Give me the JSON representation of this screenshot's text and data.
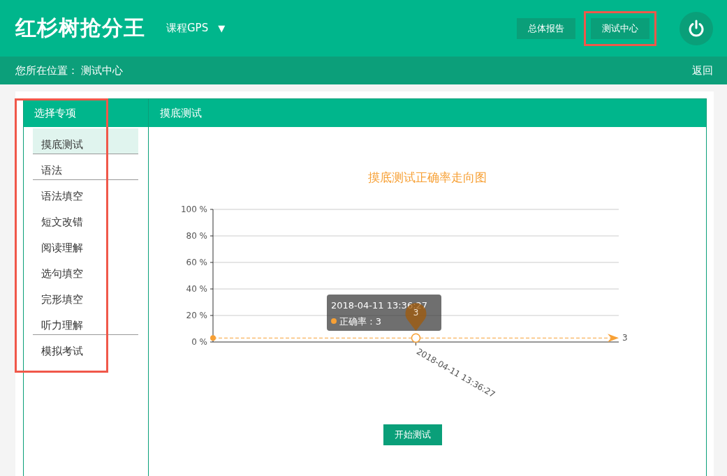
{
  "header": {
    "logo": "红杉树抢分王",
    "course_menu": "课程GPS",
    "caret": "▼",
    "nav": [
      {
        "label": "总体报告",
        "highlighted": false
      },
      {
        "label": "测试中心",
        "highlighted": true
      }
    ]
  },
  "breadcrumb": {
    "label": "您所在位置：",
    "current": "测试中心",
    "back": "返回"
  },
  "sidebar": {
    "title": "选择专项",
    "highlighted": true,
    "items": [
      {
        "label": "摸底测试",
        "selected": true,
        "divider": true
      },
      {
        "label": "语法",
        "selected": false,
        "divider": true,
        "children": [
          {
            "label": "语法填空",
            "selected": false
          },
          {
            "label": "短文改错",
            "selected": false
          }
        ]
      },
      {
        "label": "阅读理解",
        "selected": false,
        "divider": false
      },
      {
        "label": "选句填空",
        "selected": false,
        "divider": false
      },
      {
        "label": "完形填空",
        "selected": false,
        "divider": false
      },
      {
        "label": "听力理解",
        "selected": false,
        "divider": true
      },
      {
        "label": "模拟考试",
        "selected": false,
        "divider": false
      }
    ]
  },
  "main": {
    "title": "摸底测试",
    "chart_data": {
      "type": "line",
      "title": "摸底测试正确率走向图",
      "categories": [
        "2018-04-11 13:36:27"
      ],
      "series": [
        {
          "name": "正确率",
          "color": "#f7a035",
          "marker": "circle",
          "values": [
            3
          ]
        }
      ],
      "grid": true,
      "ref_lines": [
        {
          "axis": "y",
          "value": 3,
          "label": "3",
          "color": "#f7a035"
        }
      ],
      "ylim": [
        0,
        100
      ],
      "yticks": [
        {
          "value": 0,
          "label": "0 %"
        },
        {
          "value": 20,
          "label": "20 %"
        },
        {
          "value": 40,
          "label": "40 %"
        },
        {
          "value": 60,
          "label": "60 %"
        },
        {
          "value": 80,
          "label": "80 %"
        },
        {
          "value": 100,
          "label": "100 %"
        }
      ],
      "annotations": [
        {
          "text": "3",
          "x": "2018-04-11 13:36:27",
          "y": 3
        }
      ]
    },
    "tooltip": {
      "title": "2018-04-11 13:36:27",
      "value": ": 3"
    },
    "start_button": "开始测试"
  }
}
